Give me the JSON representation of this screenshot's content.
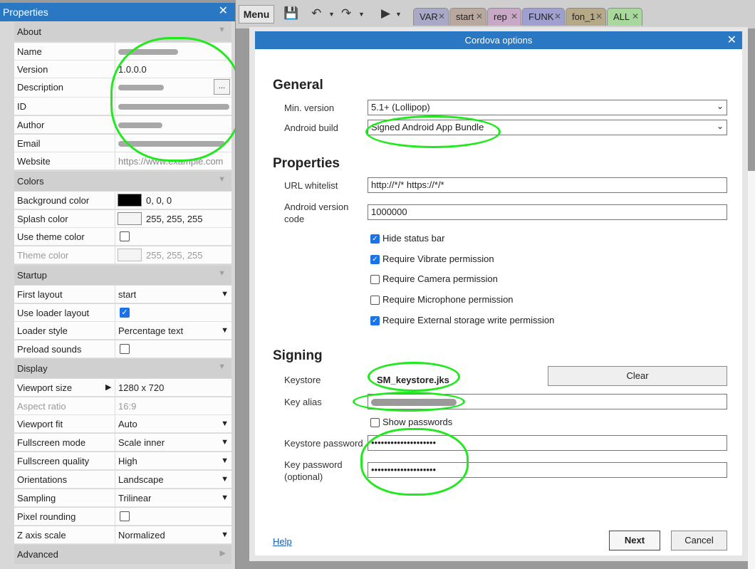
{
  "properties_panel": {
    "title": "Properties",
    "close_glyph": "✕",
    "sections": {
      "about": "About",
      "colors": "Colors",
      "startup": "Startup",
      "display": "Display",
      "advanced": "Advanced"
    },
    "about": {
      "name_label": "Name",
      "version_label": "Version",
      "version_value": "1.0.0.0",
      "description_label": "Description",
      "description_btn": "...",
      "id_label": "ID",
      "author_label": "Author",
      "email_label": "Email",
      "website_label": "Website",
      "website_value": "https://www.example.com"
    },
    "colors": {
      "background_label": "Background color",
      "background_value": "0, 0, 0",
      "background_swatch": "#000000",
      "splash_label": "Splash color",
      "splash_value": "255, 255, 255",
      "splash_swatch": "#ffffff",
      "use_theme_label": "Use theme color",
      "use_theme_checked": false,
      "theme_label": "Theme color",
      "theme_value": "255, 255, 255"
    },
    "startup": {
      "first_layout_label": "First layout",
      "first_layout_value": "start",
      "use_loader_label": "Use loader layout",
      "use_loader_checked": true,
      "loader_style_label": "Loader style",
      "loader_style_value": "Percentage text",
      "preload_label": "Preload sounds",
      "preload_checked": false
    },
    "display": {
      "viewport_size_label": "Viewport size",
      "viewport_size_value": "1280 x 720",
      "aspect_label": "Aspect ratio",
      "aspect_value": "16:9",
      "viewport_fit_label": "Viewport fit",
      "viewport_fit_value": "Auto",
      "fs_mode_label": "Fullscreen mode",
      "fs_mode_value": "Scale inner",
      "fs_quality_label": "Fullscreen quality",
      "fs_quality_value": "High",
      "orient_label": "Orientations",
      "orient_value": "Landscape",
      "sampling_label": "Sampling",
      "sampling_value": "Trilinear",
      "pixel_label": "Pixel rounding",
      "pixel_checked": false,
      "zaxis_label": "Z axis scale",
      "zaxis_value": "Normalized"
    }
  },
  "toolbar": {
    "menu_label": "Menu",
    "tabs": [
      {
        "label": "VAR",
        "color": "#a9a9c7"
      },
      {
        "label": "start",
        "color": "#b9a89d"
      },
      {
        "label": "rep",
        "color": "#c9a7c6"
      },
      {
        "label": "FUNK",
        "color": "#9f9fd0"
      },
      {
        "label": "fon_1",
        "color": "#b6a988"
      },
      {
        "label": "ALL",
        "color": "#a8d89c"
      }
    ]
  },
  "dialog": {
    "title": "Cordova options",
    "close_glyph": "✕",
    "general": {
      "heading": "General",
      "min_version_label": "Min. version",
      "min_version_value": "5.1+ (Lollipop)",
      "android_build_label": "Android build",
      "android_build_value": "Signed Android App Bundle"
    },
    "properties": {
      "heading": "Properties",
      "url_whitelist_label": "URL whitelist",
      "url_whitelist_value": "http://*/* https://*/*",
      "version_code_label": "Android version code",
      "version_code_value": "1000000",
      "checkboxes": [
        {
          "label": "Hide status bar",
          "checked": true
        },
        {
          "label": "Require Vibrate permission",
          "checked": true
        },
        {
          "label": "Require Camera permission",
          "checked": false
        },
        {
          "label": "Require Microphone permission",
          "checked": false
        },
        {
          "label": "Require External storage write permission",
          "checked": true
        }
      ]
    },
    "signing": {
      "heading": "Signing",
      "keystore_label": "Keystore",
      "keystore_value": "SM_keystore.jks",
      "clear_label": "Clear",
      "key_alias_label": "Key alias",
      "show_passwords_label": "Show passwords",
      "show_passwords_checked": false,
      "keystore_password_label": "Keystore password",
      "keystore_password_value": "••••••••••••••••••••",
      "key_password_label": "Key password (optional)",
      "key_password_value": "••••••••••••••••••••"
    },
    "footer": {
      "help_label": "Help",
      "next_label": "Next",
      "cancel_label": "Cancel"
    }
  }
}
